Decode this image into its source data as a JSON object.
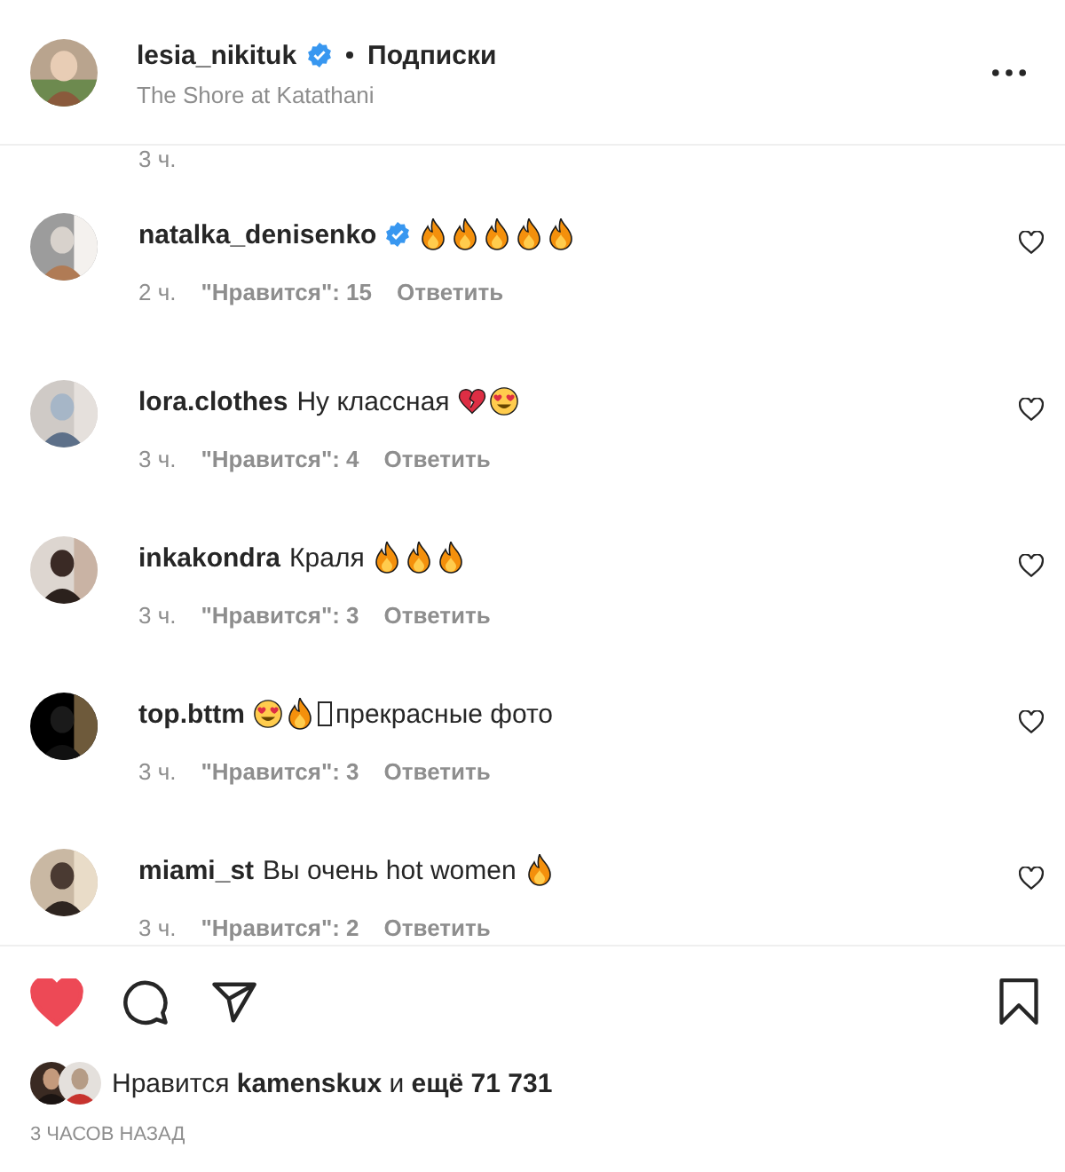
{
  "header": {
    "username": "lesia_nikituk",
    "verified": true,
    "follow": "Подписки",
    "location": "The Shore at Katathani"
  },
  "previous_meta": {
    "time": "3 ч."
  },
  "comments": [
    {
      "username": "natalka_denisenko",
      "verified": true,
      "parts": [
        {
          "kind": "fire"
        },
        {
          "kind": "fire"
        },
        {
          "kind": "fire"
        },
        {
          "kind": "fire"
        },
        {
          "kind": "fire"
        }
      ],
      "time": "2 ч.",
      "likes": "\"Нравится\": 15",
      "reply": "Ответить",
      "liked": false
    },
    {
      "username": "lora.clothes",
      "verified": false,
      "parts": [
        {
          "kind": "text",
          "text": "Ну классная"
        },
        {
          "kind": "broken_heart"
        },
        {
          "kind": "heart_eyes"
        }
      ],
      "time": "3 ч.",
      "likes": "\"Нравится\": 4",
      "reply": "Ответить",
      "liked": false
    },
    {
      "username": "inkakondra",
      "verified": false,
      "parts": [
        {
          "kind": "text",
          "text": "Краля"
        },
        {
          "kind": "fire"
        },
        {
          "kind": "fire"
        },
        {
          "kind": "fire"
        }
      ],
      "time": "3 ч.",
      "likes": "\"Нравится\": 3",
      "reply": "Ответить",
      "liked": false
    },
    {
      "username": "top.bttm",
      "verified": false,
      "parts": [
        {
          "kind": "heart_eyes"
        },
        {
          "kind": "fire"
        },
        {
          "kind": "missing_glyph"
        },
        {
          "kind": "text",
          "text": "прекрасные фото"
        }
      ],
      "time": "3 ч.",
      "likes": "\"Нравится\": 3",
      "reply": "Ответить",
      "liked": false
    },
    {
      "username": "miami_st",
      "verified": false,
      "parts": [
        {
          "kind": "text",
          "text": "Вы очень hot women"
        },
        {
          "kind": "fire"
        }
      ],
      "time": "3 ч.",
      "likes": "\"Нравится\": 2",
      "reply": "Ответить",
      "liked": false
    }
  ],
  "actions": {
    "liked": true,
    "saved": false
  },
  "likes_summary": {
    "prefix": "Нравится",
    "user": "kamenskux",
    "middle": "и",
    "rest": "ещё 71 731"
  },
  "posted": "3 ЧАСОВ НАЗАД"
}
